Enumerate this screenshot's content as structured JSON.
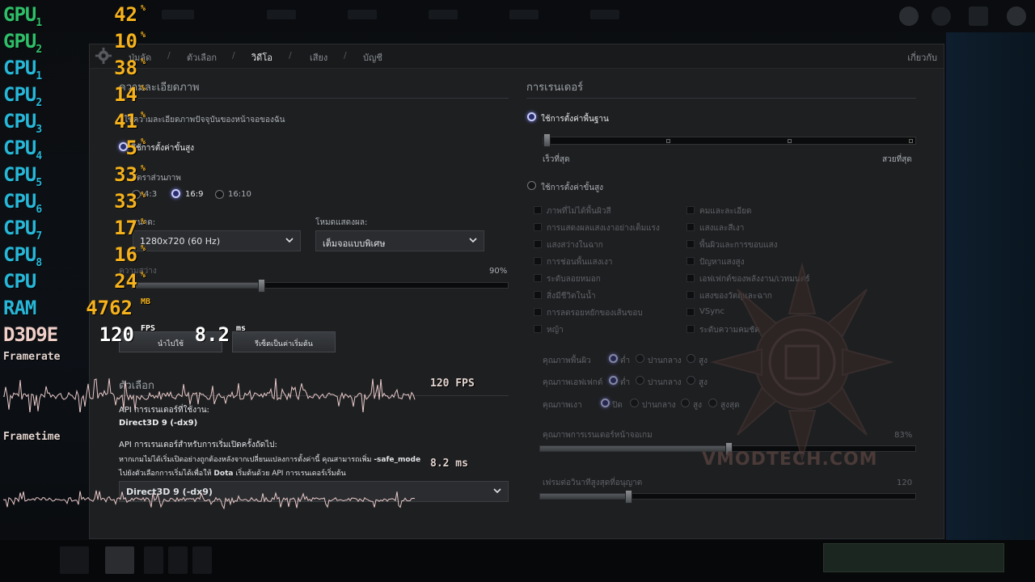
{
  "tabs": {
    "items": [
      "ปุ่มลัด",
      "ตัวเลือก",
      "วิดีโอ",
      "เสียง",
      "บัญชี"
    ],
    "active": "วิดีโอ",
    "right": "เกี่ยวกับ"
  },
  "resolution": {
    "heading": "ความละเอียดภาพ",
    "use_current": "ใช้ความละเอียดภาพปัจจุบันของหน้าจอของฉัน",
    "use_advanced": "ใช้การตั้งค่าขั้นสูง",
    "aspect_label": "อัตราส่วนภาพ",
    "aspect_options": [
      "4:3",
      "16:9",
      "16:10"
    ],
    "aspect_selected": "16:9",
    "res_label": "ขนาด:",
    "res_value": "1280x720 (60 Hz)",
    "display_label": "โหมดแสดงผล:",
    "display_value": "เต็มจอแบบพิเศษ",
    "brightness_label": "ความสว่าง",
    "brightness_value": "90%",
    "brightness_level": 0.34,
    "apply": "นำไปใช้",
    "reset": "รีเซ็ตเป็นค่าเริ่มต้น"
  },
  "options": {
    "heading": "ตัวเลือก",
    "api_label": "API การเรนเดอร์ที่ใช้งาน:",
    "api_value": "Direct3D 9 (-dx9)",
    "next_api_label": "API การเรนเดอร์สำหรับการเริ่มเปิดครั้งถัดไป:",
    "note_line1_pre": "หากเกมไม่ได้เริ่มเปิดอย่างถูกต้องหลังจากเปลี่ยนแปลงการตั้งค่านี้ คุณสามารถเพิ่ม",
    "note_line1_flag": "-safe_mode",
    "note_line2_pre": "ไปยังตัวเลือกการเริ่มได้เพื่อให้",
    "note_line2_game": "Dota",
    "note_line2_post": "เริ่มต้นด้วย API การเรนเดอร์เริ่มต้น",
    "next_api_value": "Direct3D 9 (-dx9)"
  },
  "rendering": {
    "heading": "การเรนเดอร์",
    "use_basic": "ใช้การตั้งค่าพื้นฐาน",
    "fastest": "เร็วที่สุด",
    "best": "สวยที่สุด",
    "use_advanced": "ใช้การตั้งค่าขั้นสูง",
    "checkboxes_left": [
      "ภาพที่ไม่ได้พื้นผิวสี",
      "การแสดงผลแสงเงาอย่างเต็มแรง",
      "แสงสว่างในฉาก",
      "การช่อนพื้นแสงเงา",
      "ระดับลอยหมอก",
      "สิ่งมีชีวิตในน้ำ",
      "การลดรอยหยักของเส้นขอบ",
      "หญ้า"
    ],
    "checkboxes_right": [
      "คมและละเอียด",
      "แสงและสีเงา",
      "พื้นผิวและการขอบแสง",
      "ปัญหาแสงสูง",
      "เอฟเฟกต์ของพลังงาน/เวทมนตร์",
      "แสงของวัตถุและฉาก",
      "VSync",
      "ระดับความคมชัด"
    ],
    "texture_label": "คุณภาพพื้นผิว",
    "effects_label": "คุณภาพเอฟเฟกต์",
    "shadow_label": "คุณภาพเงา",
    "opt_low": "ต่ำ",
    "opt_mid": "ปานกลาง",
    "opt_high": "สูง",
    "opt_off": "ปิด",
    "opt_ultra": "สูงสุด",
    "render_quality_label": "คุณภาพการเรนเดอร์หน้าจอเกม",
    "render_quality_value": "83%",
    "render_quality_level": 0.5,
    "max_fps_label": "เฟรมต่อวินาทีสูงสุดที่อนุญาต",
    "max_fps_value": "120",
    "max_fps_level": 0.23,
    "watermark": "VMODTECH.COM"
  },
  "osd": {
    "rows": [
      {
        "name": "GPU",
        "sub": "1",
        "value": "42",
        "unit": "%",
        "color": "#2fbf6a"
      },
      {
        "name": "GPU",
        "sub": "2",
        "value": "10",
        "unit": "%",
        "color": "#2fbf6a"
      },
      {
        "name": "CPU",
        "sub": "1",
        "value": "38",
        "unit": "%",
        "color": "#27b7d8"
      },
      {
        "name": "CPU",
        "sub": "2",
        "value": "14",
        "unit": "%",
        "color": "#27b7d8"
      },
      {
        "name": "CPU",
        "sub": "3",
        "value": "41",
        "unit": "%",
        "color": "#27b7d8"
      },
      {
        "name": "CPU",
        "sub": "4",
        "value": "5",
        "unit": "%",
        "color": "#27b7d8"
      },
      {
        "name": "CPU",
        "sub": "5",
        "value": "33",
        "unit": "%",
        "color": "#27b7d8"
      },
      {
        "name": "CPU",
        "sub": "6",
        "value": "33",
        "unit": "%",
        "color": "#27b7d8"
      },
      {
        "name": "CPU",
        "sub": "7",
        "value": "17",
        "unit": "%",
        "color": "#27b7d8"
      },
      {
        "name": "CPU",
        "sub": "8",
        "value": "16",
        "unit": "%",
        "color": "#27b7d8"
      },
      {
        "name": "CPU",
        "sub": "",
        "value": "24",
        "unit": "%",
        "color": "#27b7d8"
      },
      {
        "name": "RAM",
        "sub": "",
        "value": "4762",
        "unit": "MB",
        "color": "#27b7d8"
      }
    ],
    "d3d_name": "D3D9E",
    "fps_value": "120",
    "fps_unit": "FPS",
    "ms_value": "8.2",
    "ms_unit": "ms",
    "framerate_caption": "Framerate",
    "frametime_caption": "Frametime",
    "graph_fps": "120 FPS",
    "graph_ms": "8.2 ms"
  }
}
